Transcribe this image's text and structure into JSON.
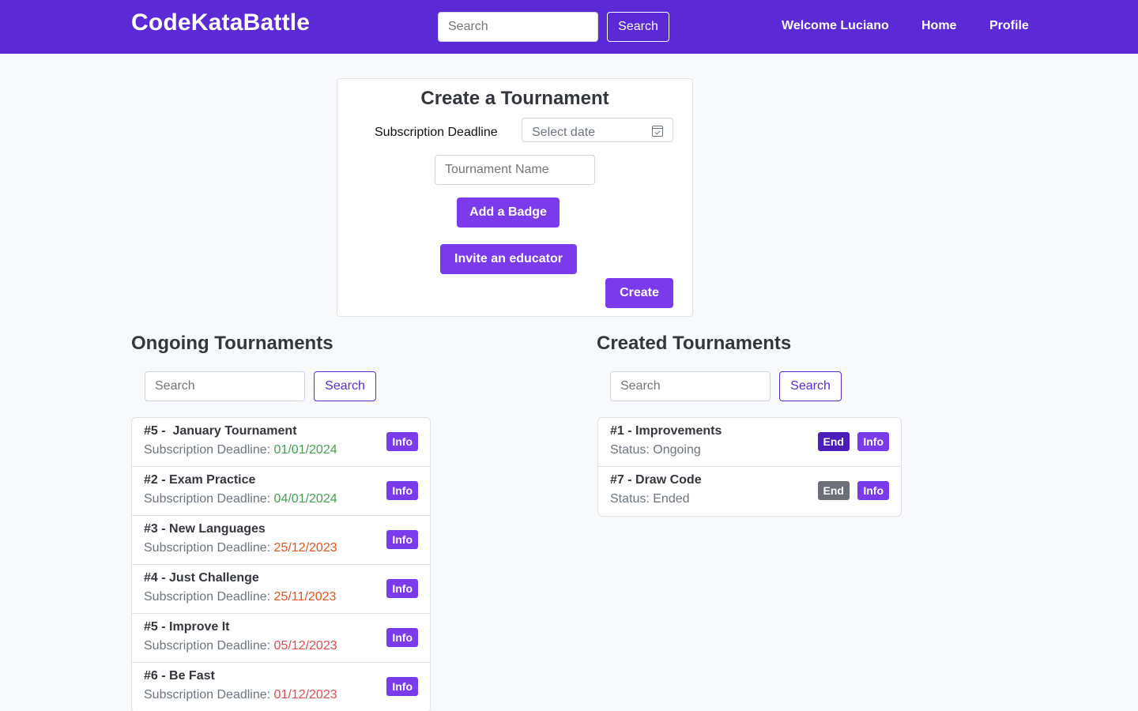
{
  "navbar": {
    "brand": "CodeKataBattle",
    "search_placeholder": "Search",
    "search_button": "Search",
    "welcome": "Welcome Luciano",
    "home": "Home",
    "profile": "Profile"
  },
  "create": {
    "title": "Create a Tournament",
    "deadline_label": "Subscription Deadline",
    "date_placeholder": "Select date",
    "name_placeholder": "Tournament Name",
    "add_badge": "Add a Badge",
    "invite": "Invite an educator",
    "create": "Create"
  },
  "ongoing": {
    "title": "Ongoing Tournaments",
    "search_placeholder": "Search",
    "search_button": "Search",
    "deadline_prefix": "Subscription Deadline: ",
    "info_label": "Info",
    "items": [
      {
        "title": "#5 -  January Tournament",
        "date": "01/01/2024",
        "date_color": "green"
      },
      {
        "title": "#2 - Exam Practice",
        "date": "04/01/2024",
        "date_color": "green"
      },
      {
        "title": "#3 - New Languages",
        "date": "25/12/2023",
        "date_color": "orange"
      },
      {
        "title": "#4 - Just Challenge",
        "date": "25/11/2023",
        "date_color": "orange"
      },
      {
        "title": "#5 - Improve It",
        "date": "05/12/2023",
        "date_color": "red"
      },
      {
        "title": "#6 - Be Fast",
        "date": "01/12/2023",
        "date_color": "red"
      }
    ]
  },
  "created": {
    "title": "Created Tournaments",
    "search_placeholder": "Search",
    "search_button": "Search",
    "end_label": "End",
    "info_label": "Info",
    "items": [
      {
        "title": "#1 - Improvements",
        "status": "Status: Ongoing",
        "end_enabled": true
      },
      {
        "title": "#7 - Draw Code",
        "status": "Status: Ended",
        "end_enabled": false
      }
    ]
  },
  "colors": {
    "navbar": "#5b2ad6",
    "accent": "#7c3aed",
    "date_green": "#3fa34d",
    "date_orange": "#e8501e",
    "date_red": "#e5484d"
  }
}
